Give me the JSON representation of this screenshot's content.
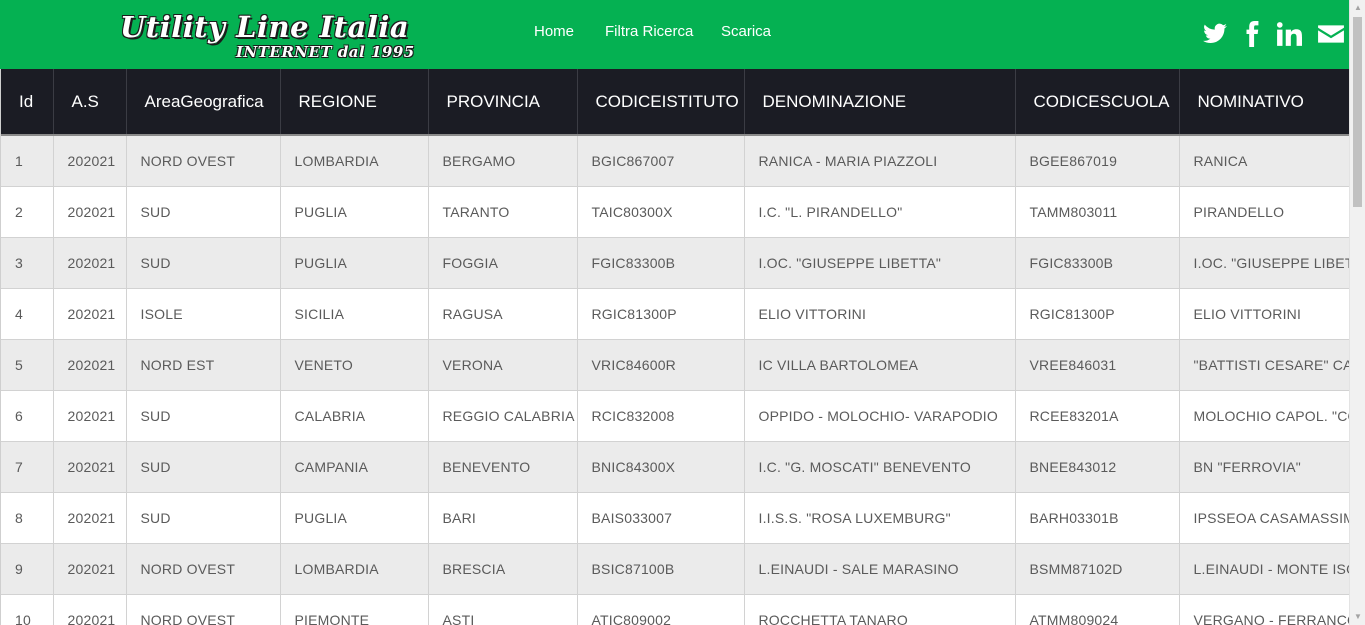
{
  "header": {
    "logo_line1": "Utility Line Italia",
    "logo_line2": "INTERNET dal 1995",
    "nav": [
      "Home",
      "Filtra Ricerca",
      "Scarica"
    ],
    "social_icons": [
      "twitter-icon",
      "facebook-icon",
      "linkedin-icon",
      "envelope-icon"
    ],
    "bg_color": "#05b152"
  },
  "table": {
    "columns": [
      "Id",
      "A.S",
      "AreaGeografica",
      "REGIONE",
      "PROVINCIA",
      "CODICEISTITUTO",
      "DENOMINAZIONE",
      "CODICESCUOLA",
      "NOMINATIVO"
    ],
    "rows": [
      [
        "1",
        "202021",
        "NORD OVEST",
        "LOMBARDIA",
        "BERGAMO",
        "BGIC867007",
        "RANICA - MARIA PIAZZOLI",
        "BGEE867019",
        "RANICA"
      ],
      [
        "2",
        "202021",
        "SUD",
        "PUGLIA",
        "TARANTO",
        "TAIC80300X",
        "I.C. \"L. PIRANDELLO\"",
        "TAMM803011",
        "PIRANDELLO"
      ],
      [
        "3",
        "202021",
        "SUD",
        "PUGLIA",
        "FOGGIA",
        "FGIC83300B",
        "I.OC. \"GIUSEPPE LIBETTA\"",
        "FGIC83300B",
        "I.OC. \"GIUSEPPE LIBETTA\""
      ],
      [
        "4",
        "202021",
        "ISOLE",
        "SICILIA",
        "RAGUSA",
        "RGIC81300P",
        "ELIO VITTORINI",
        "RGIC81300P",
        "ELIO VITTORINI"
      ],
      [
        "5",
        "202021",
        "NORD EST",
        "VENETO",
        "VERONA",
        "VRIC84600R",
        "IC VILLA BARTOLOMEA",
        "VREE846031",
        "\"BATTISTI CESARE\" CASTAGNARO"
      ],
      [
        "6",
        "202021",
        "SUD",
        "CALABRIA",
        "REGGIO CALABRIA",
        "RCIC832008",
        "OPPIDO - MOLOCHIO- VARAPODIO",
        "RCEE83201A",
        "MOLOCHIO CAPOL. \"CORRADO ALVARO\""
      ],
      [
        "7",
        "202021",
        "SUD",
        "CAMPANIA",
        "BENEVENTO",
        "BNIC84300X",
        "I.C. \"G. MOSCATI\" BENEVENTO",
        "BNEE843012",
        "BN \"FERROVIA\""
      ],
      [
        "8",
        "202021",
        "SUD",
        "PUGLIA",
        "BARI",
        "BAIS033007",
        "I.I.S.S. \"ROSA LUXEMBURG\"",
        "BARH03301B",
        "IPSSEOA CASAMASSIMA"
      ],
      [
        "9",
        "202021",
        "NORD OVEST",
        "LOMBARDIA",
        "BRESCIA",
        "BSIC87100B",
        "L.EINAUDI - SALE MARASINO",
        "BSMM87102D",
        "L.EINAUDI - MONTE ISOLA"
      ],
      [
        "10",
        "202021",
        "NORD OVEST",
        "PIEMONTE",
        "ASTI",
        "ATIC809002",
        "ROCCHETTA TANARO",
        "ATMM809024",
        "VERGANO - FERRANCO"
      ]
    ]
  }
}
